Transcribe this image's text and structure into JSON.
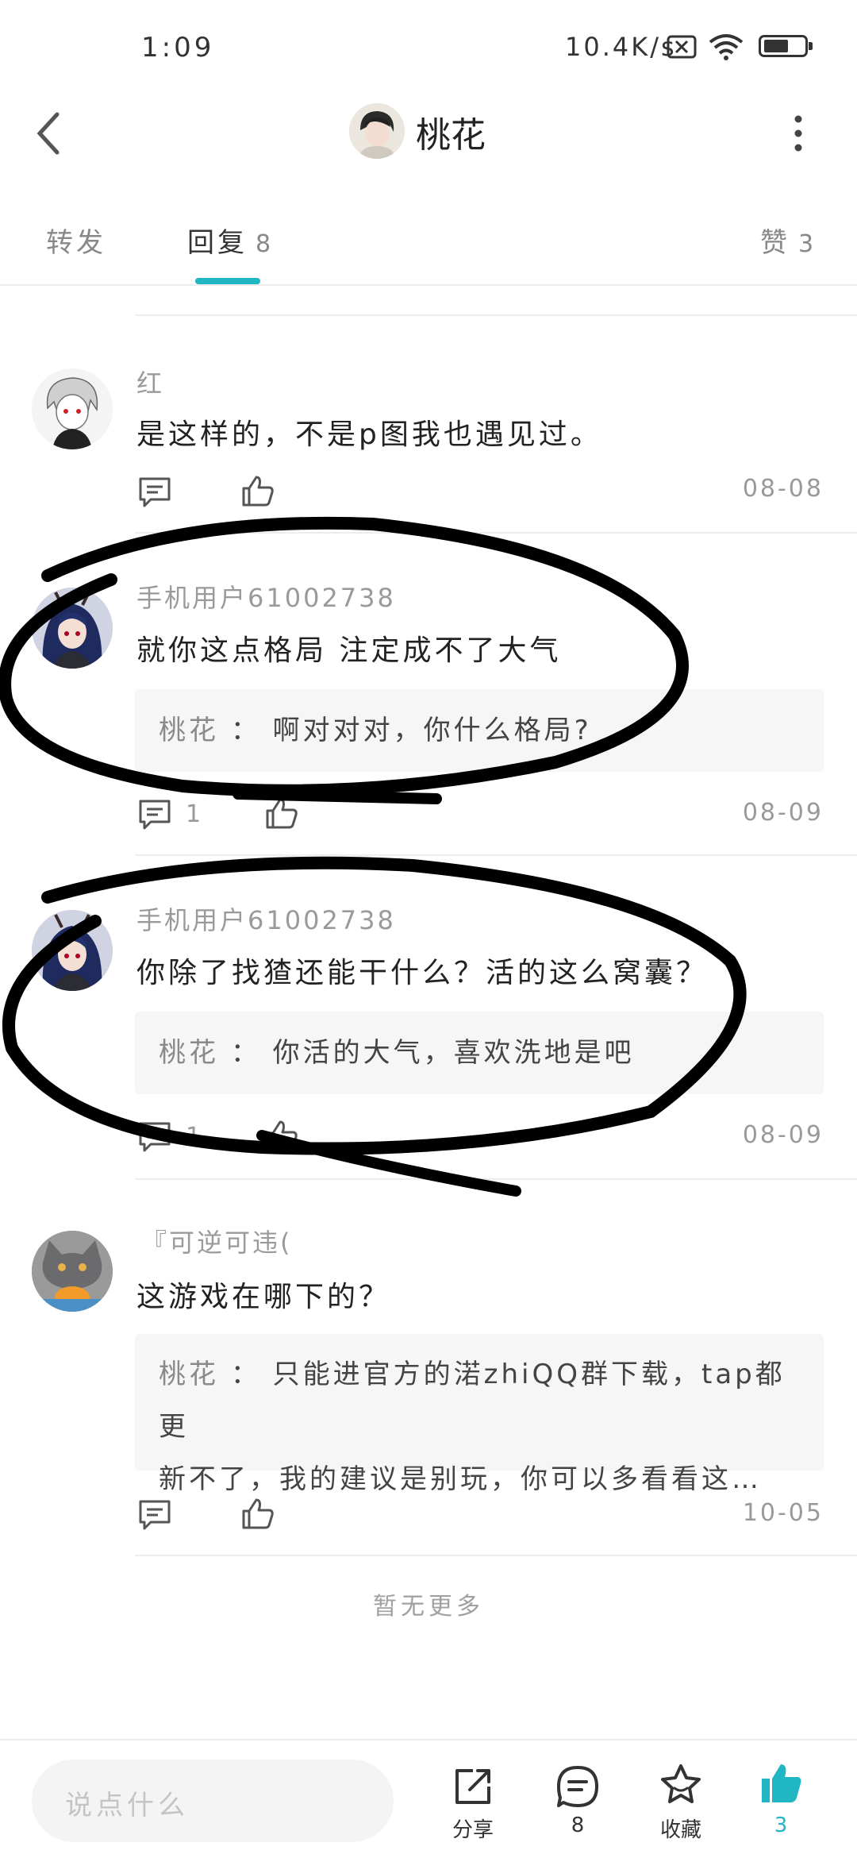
{
  "status_bar": {
    "time": "1:09",
    "network_speed": "10.4K/s",
    "battery": "56",
    "icons": [
      "sim-off-icon",
      "wifi-icon",
      "battery-icon"
    ]
  },
  "header": {
    "title": "桃花",
    "back_icon": "chevron-left-icon",
    "more_icon": "more-vertical-icon"
  },
  "tabs": [
    {
      "label": "转发",
      "count": ""
    },
    {
      "label": "回复",
      "count": "8",
      "active": true
    },
    {
      "label": "赞",
      "count": "3"
    }
  ],
  "comments": [
    {
      "username": "红",
      "text": "是这样的，不是p图我也遇见过。",
      "reply_count": "",
      "date": "08-08",
      "reply": null
    },
    {
      "username": "手机用户61002738",
      "text": "就你这点格局  注定成不了大气",
      "reply_count": "1",
      "date": "08-09",
      "reply": {
        "author": "桃花",
        "separator": "：",
        "lines": [
          "啊对对对，你什么格局?"
        ]
      }
    },
    {
      "username": "手机用户61002738",
      "text": "你除了找猹还能干什么？活的这么窝囊？",
      "reply_count": "1",
      "date": "08-09",
      "reply": {
        "author": "桃花",
        "separator": "：",
        "lines": [
          "你活的大气，喜欢洗地是吧"
        ]
      }
    },
    {
      "username": "『可逆可违(",
      "text": "这游戏在哪下的？",
      "reply_count": "",
      "date": "10-05",
      "reply": {
        "author": "桃花",
        "separator": "：",
        "lines": [
          "只能进官方的渃zhiQQ群下载，tap都更",
          "新不了，我的建议是别玩，你可以多看看这…"
        ]
      }
    }
  ],
  "footer": {
    "no_more": "暂无更多"
  },
  "bottom_bar": {
    "input_placeholder": "说点什么",
    "share_label": "分享",
    "comment_count": "8",
    "favorite_label": "收藏",
    "like_count": "3",
    "accent_color": "#20b6c4"
  }
}
